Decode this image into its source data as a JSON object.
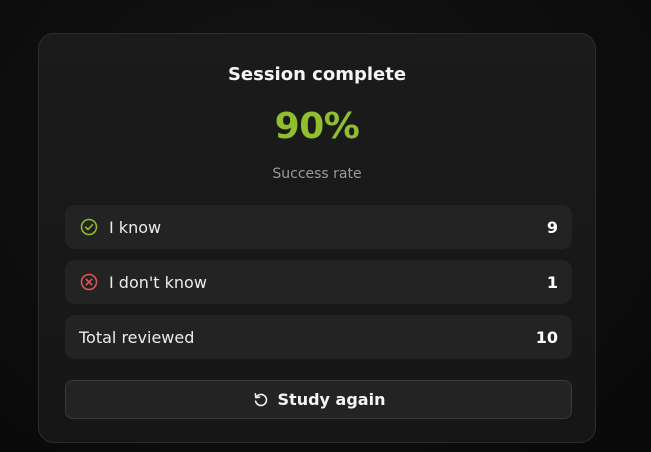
{
  "summary": {
    "title": "Session complete",
    "success_rate": "90%",
    "success_rate_label": "Success rate"
  },
  "stats": {
    "know": {
      "label": "I know",
      "value": "9",
      "icon": "check-circle-icon"
    },
    "dont_know": {
      "label": "I don't know",
      "value": "1",
      "icon": "x-circle-icon"
    },
    "total": {
      "label": "Total reviewed",
      "value": "10"
    }
  },
  "actions": {
    "study_again_label": "Study again",
    "study_again_icon": "refresh-icon"
  },
  "colors": {
    "success": "#8fbf2e",
    "danger": "#e05555",
    "background": "#0b0b0b",
    "card": "#1a1a1a",
    "row": "#232323"
  }
}
